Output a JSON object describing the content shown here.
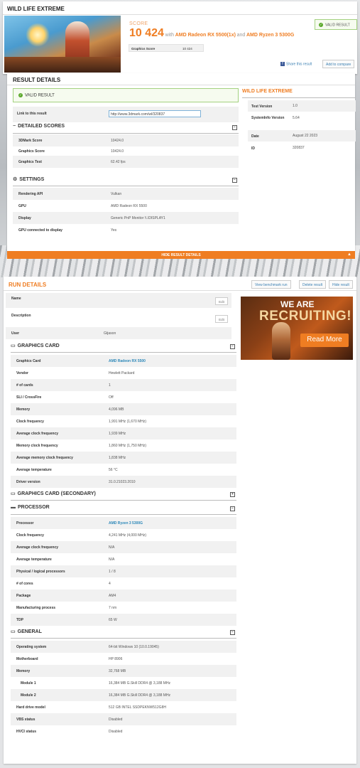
{
  "top": {
    "title": "WILD LIFE EXTREME",
    "score_label": "SCORE",
    "score": "10 424",
    "with": "with",
    "gpu": "AMD Radeon RX 5500(1x)",
    "and": "and",
    "cpu": "AMD Ryzen 3 5300G",
    "gs_label": "Graphics Score",
    "gs_value": "10 424",
    "valid": "VALID RESULT",
    "share": "Share this result",
    "compare": "Add to compare"
  },
  "result": {
    "title": "RESULT DETAILS",
    "valid": "VALID RESULT",
    "link_label": "Link to this result",
    "link_value": "http://www.3dmark.com/wl/320837",
    "scores_head": "DETAILED SCORES",
    "scores": [
      {
        "k": "3DMark Score",
        "v": "10424.0"
      },
      {
        "k": "Graphics Score",
        "v": "10424.0"
      },
      {
        "k": "Graphics Test",
        "v": "62.42 fps"
      }
    ],
    "settings_head": "SETTINGS",
    "settings": [
      {
        "k": "Rendering API",
        "v": "Vulkan"
      },
      {
        "k": "GPU",
        "v": "AMD Radeon RX 5500"
      },
      {
        "k": "Display",
        "v": "Generic PnP Monitor \\\\.\\DISPLAY1"
      },
      {
        "k": "GPU connected to display",
        "v": "Yes"
      }
    ],
    "side_head": "WILD LIFE EXTREME",
    "side": [
      {
        "k": "Test Version",
        "v": "1.0"
      },
      {
        "k": "SystemInfo Version",
        "v": "5.64"
      },
      {
        "k": "Date",
        "v": "August 22 2023"
      },
      {
        "k": "ID",
        "v": "320837"
      }
    ],
    "hide": "HIDE RESULT DETAILS"
  },
  "run": {
    "title": "RUN DETAILS",
    "view_btn": "View benchmark run",
    "delete_btn": "Delete result",
    "hide_btn": "Hide result",
    "edit": "Edit",
    "name_label": "Name",
    "desc_label": "Description",
    "user_label": "User",
    "user_value": "Gtjason",
    "gc_head": "GRAPHICS CARD",
    "gc": [
      {
        "k": "Graphics Card",
        "v": "AMD Radeon RX 5500"
      },
      {
        "k": "Vendor",
        "v": "Hewlett Packard"
      },
      {
        "k": "# of cards",
        "v": "1"
      },
      {
        "k": "SLI / CrossFire",
        "v": "Off"
      },
      {
        "k": "Memory",
        "v": "4,096 MB"
      },
      {
        "k": "Clock frequency",
        "v": "1,991 MHz (1,670 MHz)"
      },
      {
        "k": "Average clock frequency",
        "v": "1,939 MHz"
      },
      {
        "k": "Memory clock frequency",
        "v": "1,860 MHz (1,750 MHz)"
      },
      {
        "k": "Average memory clock frequency",
        "v": "1,838 MHz"
      },
      {
        "k": "Average temperature",
        "v": "56 °C"
      },
      {
        "k": "Driver version",
        "v": "31.0.21023.2010"
      }
    ],
    "gc2_head": "GRAPHICS CARD (SECONDARY)",
    "cpu_head": "PROCESSOR",
    "cpu": [
      {
        "k": "Processor",
        "v": "AMD Ryzen 3 5300G"
      },
      {
        "k": "Clock frequency",
        "v": "4,241 MHz (4,000 MHz)"
      },
      {
        "k": "Average clock frequency",
        "v": "N/A"
      },
      {
        "k": "Average temperature",
        "v": "N/A"
      },
      {
        "k": "Physical / logical processors",
        "v": "1 / 8"
      },
      {
        "k": "# of cores",
        "v": "4"
      },
      {
        "k": "Package",
        "v": "AM4"
      },
      {
        "k": "Manufacturing process",
        "v": "7 nm"
      },
      {
        "k": "TDP",
        "v": "65 W"
      }
    ],
    "gen_head": "GENERAL",
    "gen": [
      {
        "k": "Operating system",
        "v": "64-bit Windows 10 (10.0.19045)"
      },
      {
        "k": "Motherboard",
        "v": "HP 8906"
      },
      {
        "k": "Memory",
        "v": "32,768 MB"
      },
      {
        "k": "Module 1",
        "v": "16,384 MB G.Skill DDR4 @ 3,188 MHz"
      },
      {
        "k": "Module 2",
        "v": "16,384 MB G.Skill DDR4 @ 3,188 MHz"
      },
      {
        "k": "Hard drive model",
        "v": "512 GB INTEL SSDPEKNW512G8H"
      },
      {
        "k": "VBS status",
        "v": "Disabled"
      },
      {
        "k": "HVCI status",
        "v": "Disabled"
      }
    ],
    "ad_we": "WE ARE",
    "ad_rec": "RECRUITING!",
    "ad_more": "Read More"
  },
  "icons": {
    "check": "check-icon",
    "facebook": "facebook-icon",
    "toggle": "collapse-icon",
    "arrow": "chevron-up-icon"
  },
  "colors": {
    "accent": "#ef7d22",
    "link": "#2b87b8",
    "valid": "#5aa82a"
  }
}
